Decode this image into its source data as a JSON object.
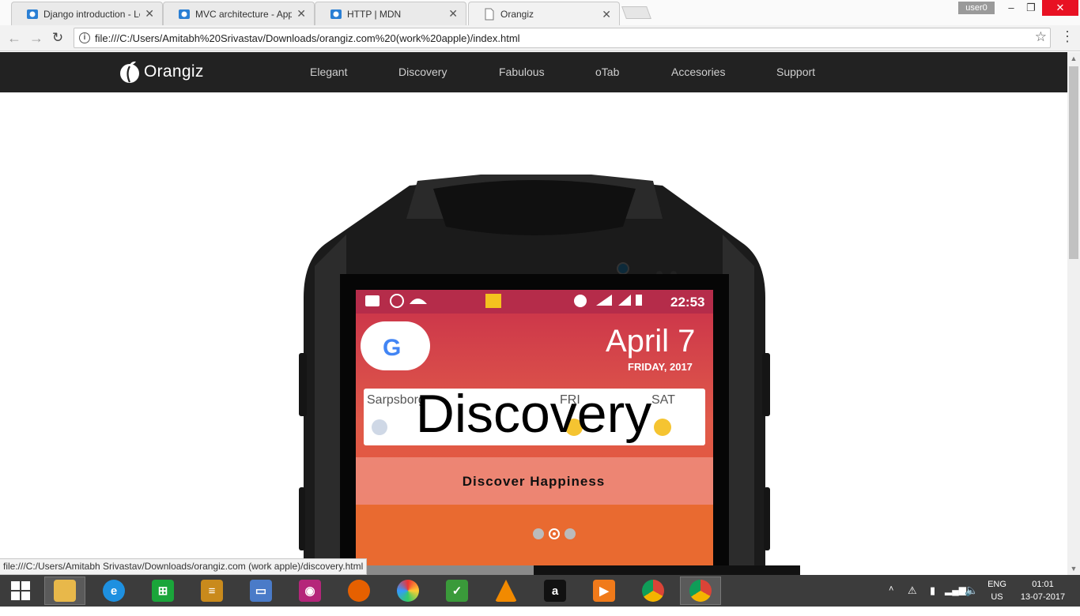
{
  "browser": {
    "tabs": [
      {
        "title": "Django introduction - Le",
        "favicon": "mdn-favicon-icon",
        "active": false
      },
      {
        "title": "MVC architecture - App",
        "favicon": "mdn-favicon-icon",
        "active": false
      },
      {
        "title": "HTTP | MDN",
        "favicon": "mdn-favicon-icon",
        "active": false
      },
      {
        "title": "Orangiz",
        "favicon": "page-icon",
        "active": true
      }
    ],
    "user": "user0",
    "window_controls": {
      "minimize": "–",
      "restore": "❐",
      "close": "✕"
    },
    "url": "file:///C:/Users/Amitabh%20Srivastav/Downloads/orangiz.com%20(work%20apple)/index.html",
    "status_url": "file:///C:/Users/Amitabh Srivastav/Downloads/orangiz.com (work apple)/discovery.html"
  },
  "site": {
    "brand": "Orangiz",
    "nav": [
      "Elegant",
      "Discovery",
      "Fabulous",
      "oTab",
      "Accesories",
      "Support"
    ],
    "hero": {
      "title": "Discovery",
      "subtitle": "Discover Happiness",
      "slides": 3,
      "active_slide": 2
    },
    "phone_screen": {
      "time": "22:53",
      "date": "April 7",
      "day": "FRIDAY, 2017",
      "weather": {
        "city": "Sarpsborg",
        "col2": "FRI",
        "col3": "SAT"
      }
    }
  },
  "taskbar": {
    "apps": [
      "start-icon",
      "file-explorer-icon",
      "internet-explorer-icon",
      "store-icon",
      "notes-icon",
      "remote-desktop-icon",
      "camera-icon",
      "firefox-icon",
      "color-picker-icon",
      "tasks-icon",
      "vlc-icon",
      "amazon-icon",
      "media-player-icon",
      "chrome-icon",
      "chrome-active-icon"
    ],
    "language": {
      "line1": "ENG",
      "line2": "US"
    },
    "clock": {
      "time": "01:01",
      "date": "13-07-2017"
    }
  },
  "colors": {
    "navbar": "#222222",
    "accent_red": "#e81123",
    "taskbar": "#3c3c3c"
  }
}
